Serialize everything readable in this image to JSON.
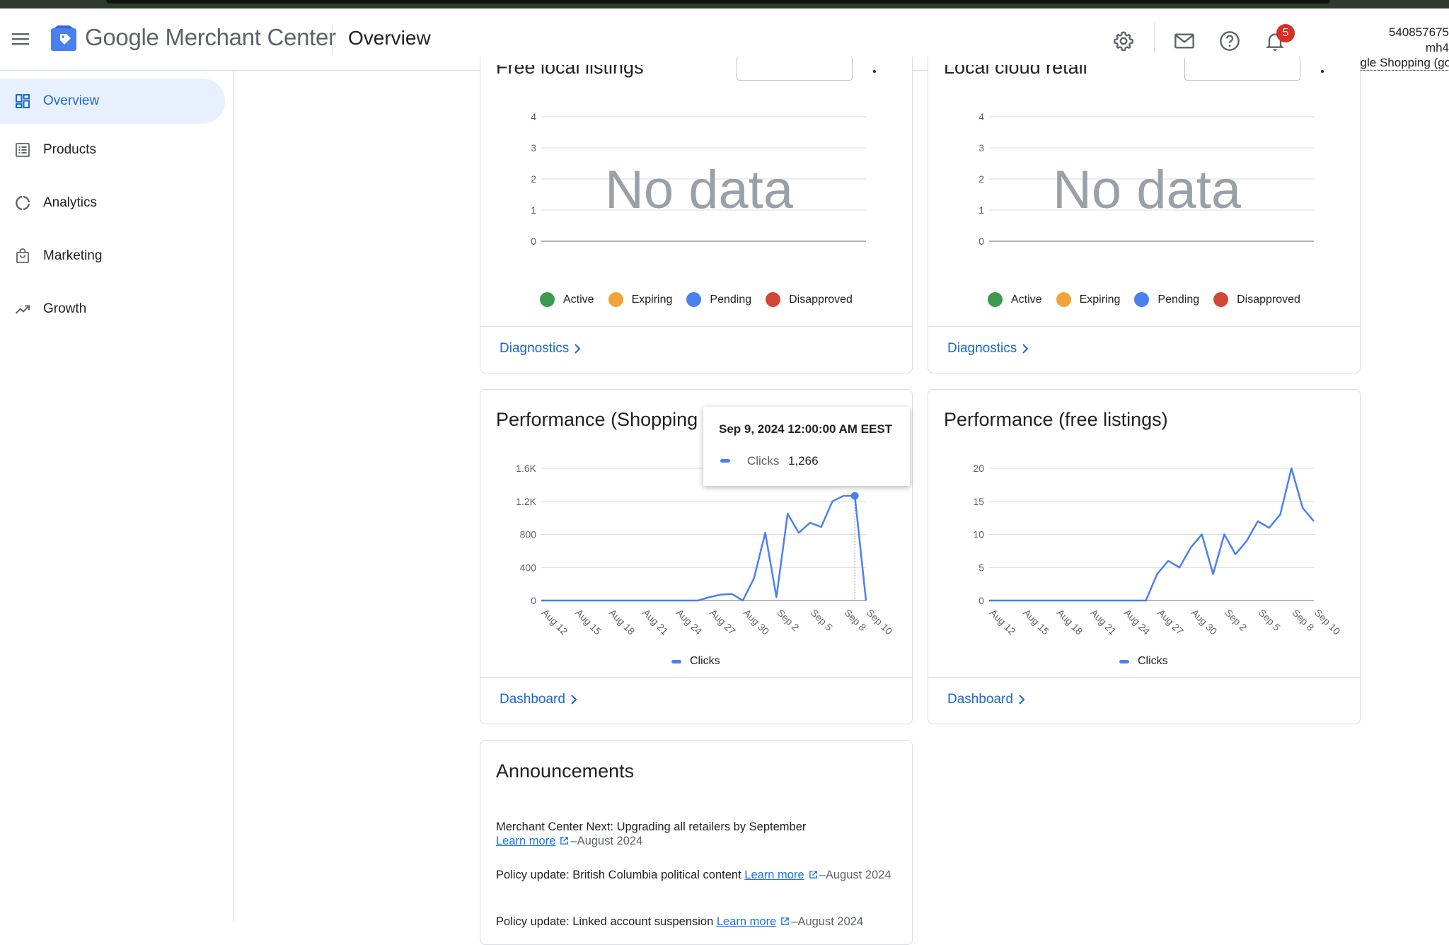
{
  "header": {
    "brand_google": "Google",
    "brand_product": "Merchant Center",
    "page_title": "Overview",
    "notifications_count": "5",
    "account_id": "540857675",
    "account_name": "mh4",
    "account_css": "CSS: Google Shopping (goo"
  },
  "sidebar": {
    "items": [
      {
        "label": "Overview",
        "icon": "dashboard-icon",
        "active": true
      },
      {
        "label": "Products",
        "icon": "products-list-icon"
      },
      {
        "label": "Analytics",
        "icon": "analytics-ring-icon"
      },
      {
        "label": "Marketing",
        "icon": "shopping-bag-icon"
      },
      {
        "label": "Growth",
        "icon": "trending-up-icon"
      }
    ]
  },
  "cards": {
    "free_local": {
      "title": "Free local listings",
      "no_data": "No data",
      "legend": [
        "Active",
        "Expiring",
        "Pending",
        "Disapproved"
      ],
      "footer_link": "Diagnostics"
    },
    "local_cloud": {
      "title": "Local cloud retail",
      "no_data": "No data",
      "legend": [
        "Active",
        "Expiring",
        "Pending",
        "Disapproved"
      ],
      "footer_link": "Diagnostics"
    },
    "perf_shopping": {
      "title": "Performance (Shopping ads)",
      "legend": "Clicks",
      "footer_link": "Dashboard",
      "tooltip": {
        "title": "Sep 9, 2024 12:00:00 AM EEST",
        "label": "Clicks",
        "value": "1,266"
      }
    },
    "perf_free": {
      "title": "Performance (free listings)",
      "legend": "Clicks",
      "footer_link": "Dashboard"
    },
    "announcements": {
      "title": "Announcements",
      "items": [
        {
          "text": "Merchant Center Next: Upgrading all retailers by September",
          "link": "Learn more",
          "date": "–August 2024"
        },
        {
          "text": "Policy update: British Columbia political content ",
          "link": "Learn more",
          "date": "–August 2024"
        },
        {
          "text": "Policy update: Linked account suspension ",
          "link": "Learn more",
          "date": "–August 2024"
        }
      ]
    }
  },
  "colors": {
    "accent": "#1967d2",
    "line": "#4a80ee",
    "active": "#3c9a4e",
    "expiring": "#f2a33a",
    "pending": "#4a80ee",
    "disapproved": "#d0473a"
  },
  "chart_data": [
    {
      "type": "line",
      "title": "Free local listings",
      "yticks": [
        0,
        1,
        2,
        3,
        4
      ],
      "ylim": [
        0,
        4
      ],
      "series": [],
      "legend": [
        "Active",
        "Expiring",
        "Pending",
        "Disapproved"
      ]
    },
    {
      "type": "line",
      "title": "Local cloud retail",
      "yticks": [
        0,
        1,
        2,
        3,
        4
      ],
      "ylim": [
        0,
        4
      ],
      "series": [],
      "legend": [
        "Active",
        "Expiring",
        "Pending",
        "Disapproved"
      ]
    },
    {
      "type": "line",
      "title": "Performance (Shopping ads)",
      "xticks": [
        "Aug 12",
        "Aug 15",
        "Aug 18",
        "Aug 21",
        "Aug 24",
        "Aug 27",
        "Aug 30",
        "Sep 2",
        "Sep 5",
        "Sep 8",
        "Sep 10"
      ],
      "yticks": [
        "0",
        "400",
        "800",
        "1.2K",
        "1.6K"
      ],
      "ylim": [
        0,
        1600
      ],
      "x": [
        "Aug 12",
        "Aug 13",
        "Aug 14",
        "Aug 15",
        "Aug 16",
        "Aug 17",
        "Aug 18",
        "Aug 19",
        "Aug 20",
        "Aug 21",
        "Aug 22",
        "Aug 23",
        "Aug 24",
        "Aug 25",
        "Aug 26",
        "Aug 27",
        "Aug 28",
        "Aug 29",
        "Aug 30",
        "Aug 31",
        "Sep 1",
        "Sep 2",
        "Sep 3",
        "Sep 4",
        "Sep 5",
        "Sep 6",
        "Sep 7",
        "Sep 8",
        "Sep 9",
        "Sep 10"
      ],
      "series": [
        {
          "name": "Clicks",
          "values": [
            0,
            0,
            0,
            0,
            0,
            0,
            0,
            0,
            0,
            0,
            0,
            0,
            0,
            0,
            0,
            40,
            70,
            80,
            0,
            270,
            820,
            40,
            1050,
            820,
            940,
            890,
            1200,
            1266,
            1266,
            0
          ]
        }
      ],
      "highlight": {
        "x": "Sep 9",
        "value": 1266
      }
    },
    {
      "type": "line",
      "title": "Performance (free listings)",
      "xticks": [
        "Aug 12",
        "Aug 15",
        "Aug 18",
        "Aug 21",
        "Aug 24",
        "Aug 27",
        "Aug 30",
        "Sep 2",
        "Sep 5",
        "Sep 8",
        "Sep 10"
      ],
      "yticks": [
        "0",
        "5",
        "10",
        "15",
        "20"
      ],
      "ylim": [
        0,
        20
      ],
      "x": [
        "Aug 12",
        "Aug 13",
        "Aug 14",
        "Aug 15",
        "Aug 16",
        "Aug 17",
        "Aug 18",
        "Aug 19",
        "Aug 20",
        "Aug 21",
        "Aug 22",
        "Aug 23",
        "Aug 24",
        "Aug 25",
        "Aug 26",
        "Aug 27",
        "Aug 28",
        "Aug 29",
        "Aug 30",
        "Aug 31",
        "Sep 1",
        "Sep 2",
        "Sep 3",
        "Sep 4",
        "Sep 5",
        "Sep 6",
        "Sep 7",
        "Sep 8",
        "Sep 9",
        "Sep 10"
      ],
      "series": [
        {
          "name": "Clicks",
          "values": [
            0,
            0,
            0,
            0,
            0,
            0,
            0,
            0,
            0,
            0,
            0,
            0,
            0,
            0,
            0,
            4,
            6,
            5,
            8,
            10,
            4,
            10,
            7,
            9,
            12,
            11,
            13,
            20,
            14,
            12
          ]
        }
      ]
    }
  ]
}
